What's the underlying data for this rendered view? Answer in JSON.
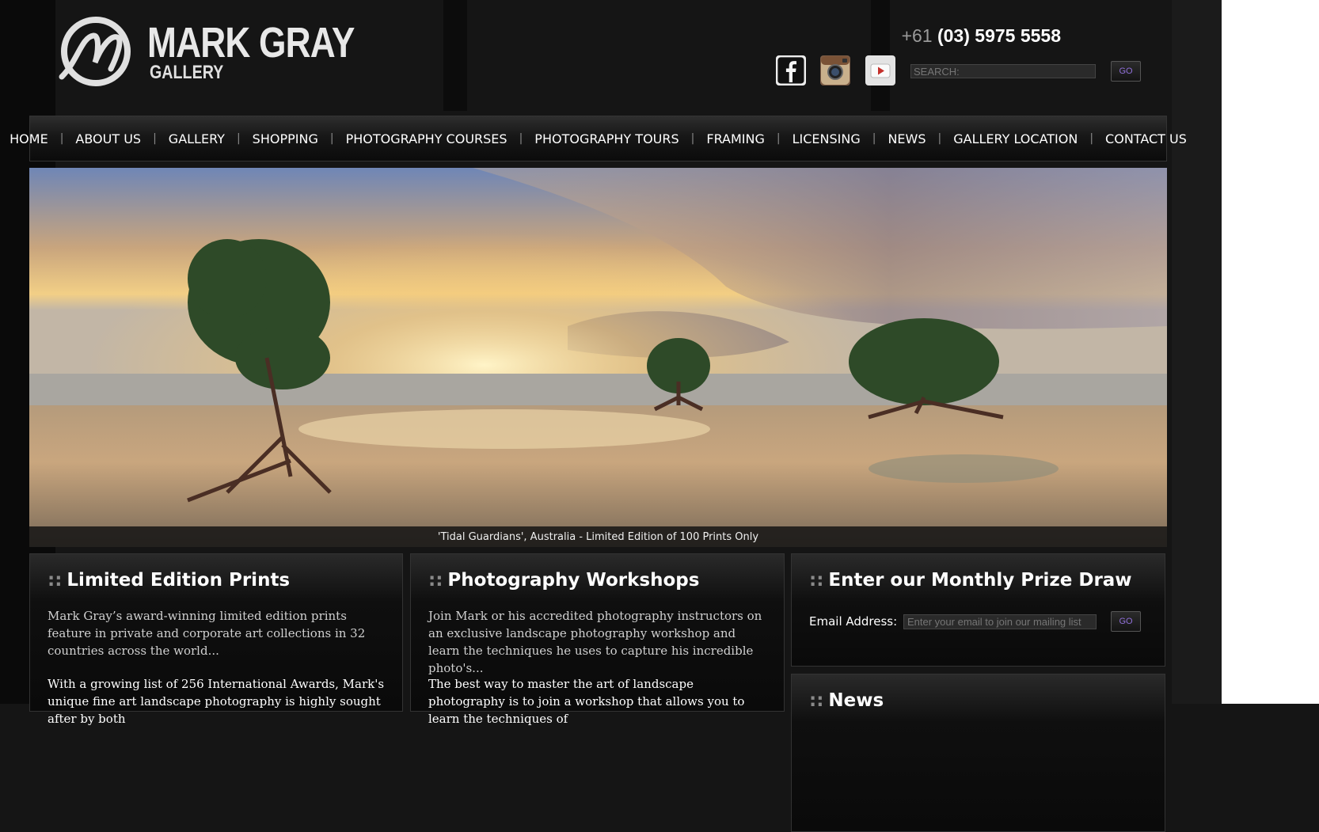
{
  "header": {
    "logo_main": "MARK GRAY",
    "logo_sub": "GALLERY",
    "phone_prefix": "+61",
    "phone_number": "(03) 5975 5558",
    "search_placeholder": "SEARCH:",
    "search_go": "GO",
    "social": [
      "facebook-icon",
      "instagram-icon",
      "youtube-icon"
    ]
  },
  "nav": {
    "items": [
      "HOME",
      "ABOUT US",
      "GALLERY",
      "SHOPPING",
      "PHOTOGRAPHY COURSES",
      "PHOTOGRAPHY TOURS",
      "FRAMING",
      "LICENSING",
      "NEWS",
      "GALLERY LOCATION",
      "CONTACT US"
    ],
    "separator": "|"
  },
  "hero": {
    "caption": "'Tidal Guardians', Australia - Limited Edition of 100 Prints Only"
  },
  "panels": {
    "prints": {
      "title": "Limited Edition Prints",
      "text1": "Mark Gray’s award-winning limited edition prints feature in private and corporate art collections in 32 countries across the world...",
      "text2": "With a growing list of 256 International Awards, Mark's unique fine art landscape photography is highly sought after by both"
    },
    "workshops": {
      "title": "Photography Workshops",
      "text1": "Join Mark or his accredited photography instructors on an exclusive landscape photography workshop and learn the techniques he uses to capture his incredible photo's...",
      "text2": "The best way to master the art of landscape photography is to join a workshop that allows you to learn the techniques of"
    },
    "prize": {
      "title": "Enter our Monthly Prize Draw",
      "email_label": "Email Address:",
      "email_placeholder": "Enter your email to join our mailing list",
      "go": "GO"
    },
    "news": {
      "title": "News"
    },
    "dots": "::"
  },
  "colors": {
    "accent_go": "#8f6fd8",
    "background": "#151515"
  }
}
